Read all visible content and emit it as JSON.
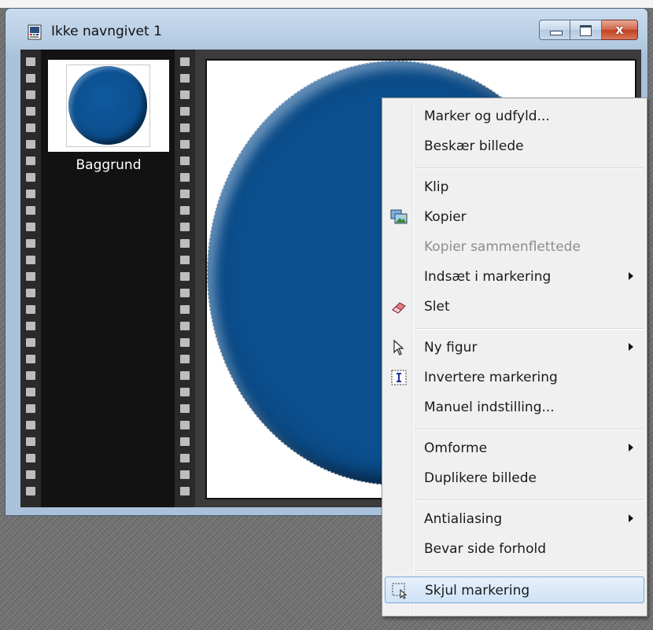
{
  "window": {
    "title": "Ikke navngivet 1",
    "buttons": {
      "minimize": "minimize",
      "maximize": "maximize",
      "close": "x"
    }
  },
  "filmstrip": {
    "thumbnail_label": "Baggrund"
  },
  "context_menu": {
    "groups": [
      [
        {
          "label": "Marker og udfyld...",
          "icon": "",
          "submenu": false,
          "enabled": true
        },
        {
          "label": "Beskær billede",
          "icon": "",
          "submenu": false,
          "enabled": true
        }
      ],
      [
        {
          "label": "Klip",
          "icon": "",
          "submenu": false,
          "enabled": true
        },
        {
          "label": "Kopier",
          "icon": "copy-picture-icon",
          "submenu": false,
          "enabled": true
        },
        {
          "label": "Kopier sammenflettede",
          "icon": "",
          "submenu": false,
          "enabled": false
        },
        {
          "label": "Indsæt i markering",
          "icon": "",
          "submenu": true,
          "enabled": true
        },
        {
          "label": "Slet",
          "icon": "eraser-icon",
          "submenu": false,
          "enabled": true
        }
      ],
      [
        {
          "label": "Ny figur",
          "icon": "pointer-icon",
          "submenu": true,
          "enabled": true
        },
        {
          "label": "Invertere markering",
          "icon": "invert-selection-icon",
          "submenu": false,
          "enabled": true
        },
        {
          "label": "Manuel indstilling...",
          "icon": "",
          "submenu": false,
          "enabled": true
        }
      ],
      [
        {
          "label": "Omforme",
          "icon": "",
          "submenu": true,
          "enabled": true
        },
        {
          "label": "Duplikere billede",
          "icon": "",
          "submenu": false,
          "enabled": true
        }
      ],
      [
        {
          "label": "Antialiasing",
          "icon": "",
          "submenu": true,
          "enabled": true
        },
        {
          "label": "Bevar side forhold",
          "icon": "",
          "submenu": false,
          "enabled": true
        }
      ],
      [
        {
          "label": "Skjul markering",
          "icon": "hide-selection-icon",
          "submenu": false,
          "enabled": true,
          "highlighted": true
        }
      ]
    ]
  },
  "colors": {
    "circle_blue": "#0b4f8e",
    "menu_background": "#f0f0f0",
    "highlight": "#cfe2f7"
  }
}
